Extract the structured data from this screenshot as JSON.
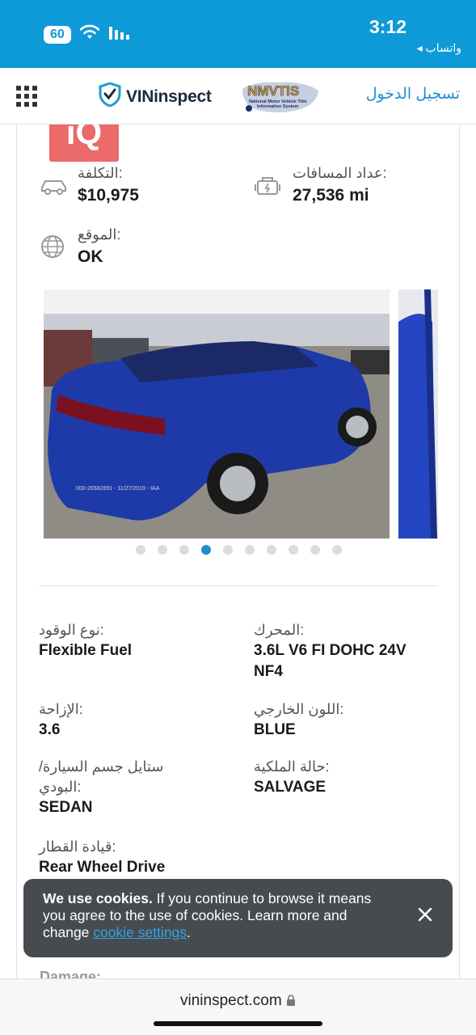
{
  "status_bar": {
    "battery": "60",
    "time": "3:12",
    "back_app": "◂ واتساب"
  },
  "header": {
    "logo_text": "VINinspect",
    "nmvtis_title": "NMVTIS",
    "nmvtis_subtitle_1": "National Motor Vehicle Title",
    "nmvtis_subtitle_2": "Information System",
    "login": "تسجيل الدخول"
  },
  "watermark": "iQ",
  "summary": {
    "cost": {
      "label": ":التكلفة",
      "value": "$10,975",
      "icon": "car-icon"
    },
    "mileage": {
      "label": ":عداد المسافات",
      "value": "27,536 mi",
      "icon": "engine-icon"
    },
    "location": {
      "label": ":الموقع",
      "value": "OK",
      "icon": "globe-icon"
    }
  },
  "gallery": {
    "total_images": 10,
    "active_index": 3,
    "photo_watermark": "000-26582891 - 11/27/2019 - IAA"
  },
  "specs": {
    "fuel_type": {
      "label": ":نوع الوقود",
      "value": "Flexible Fuel"
    },
    "engine": {
      "label": ":المحرك",
      "value": "3.6L V6 FI DOHC 24V NF4"
    },
    "displacement": {
      "label": ":الإزاحة",
      "value": "3.6"
    },
    "exterior_color": {
      "label": ":اللون الخارجي",
      "value": "BLUE"
    },
    "body_style": {
      "label": "ستايل جسم السيارة/ :البودي",
      "value": "SEDAN"
    },
    "title_status": {
      "label": ":حالة الملكية",
      "value": "SALVAGE"
    },
    "drive": {
      "label": ":قيادة القطار",
      "value": "Rear Wheel Drive"
    }
  },
  "damage_peek": "Damage:",
  "cookie_banner": {
    "bold": "We use cookies.",
    "text": " If you continue to browse it means you agree to the use of cookies. Learn more and change ",
    "link": "cookie settings",
    "end": "."
  },
  "url_bar": {
    "domain": "vininspect.com"
  },
  "colors": {
    "status_bar": "#0e9ad8",
    "accent": "#1d8fd0",
    "cookie_bg": "#474b4f"
  }
}
